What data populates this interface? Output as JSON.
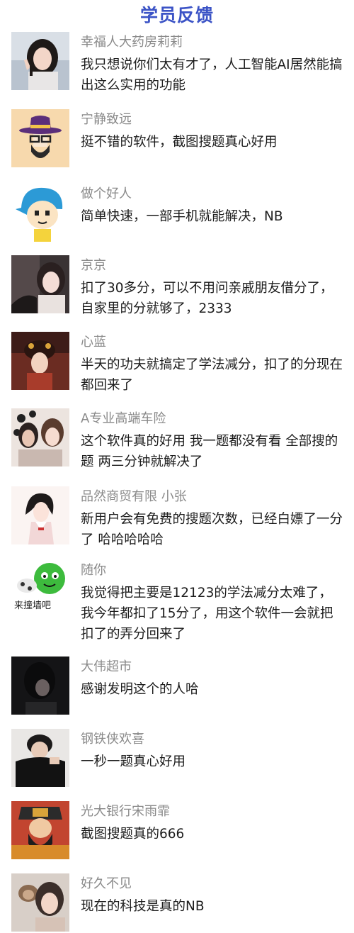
{
  "header": {
    "title": "学员反馈"
  },
  "reviews": [
    {
      "name": "幸福人大药房莉莉",
      "text": "我只想说你们太有才了，人工智能AI居然能搞出这么实用的功能",
      "avatar_icon": "girl-photo-avatar"
    },
    {
      "name": "宁静致远",
      "text": "挺不错的软件，截图搜题真心好用",
      "avatar_icon": "hat-glasses-man-avatar"
    },
    {
      "name": "做个好人",
      "text": "简单快速，一部手机就能解决，NB",
      "avatar_icon": "cartoon-boy-cap-avatar"
    },
    {
      "name": "京京",
      "text": "扣了30多分，可以不用问亲戚朋友借分了，自家里的分就够了，2333",
      "avatar_icon": "girl-in-car-avatar"
    },
    {
      "name": "心蓝",
      "text": "半天的功夫就搞定了学法减分，扣了的分现在都回来了",
      "avatar_icon": "costume-woman-avatar"
    },
    {
      "name": "A专业高端车险",
      "text": "这个软件真的好用 我一题都没有看 全部搜的题 两三分钟就解决了",
      "avatar_icon": "couple-photo-avatar"
    },
    {
      "name": "品然商贸有限 小张",
      "text": "新用户会有免费的搜题次数，已经白嫖了一分了 哈哈哈哈哈",
      "avatar_icon": "illustrated-girl-avatar"
    },
    {
      "name": "随你",
      "text": "我觉得把主要是12123的学法减分太难了，我今年都扣了15分了，用这个软件一会就把扣了的弄分回来了",
      "avatar_icon": "green-monster-sticker-avatar",
      "avatar_caption": "来撞墙吧"
    },
    {
      "name": "大伟超市",
      "text": "感谢发明这个的人哈",
      "avatar_icon": "dark-portrait-avatar"
    },
    {
      "name": "钢铁侠欢喜",
      "text": "一秒一题真心好用",
      "avatar_icon": "boy-covering-face-avatar"
    },
    {
      "name": "光大银行宋雨霏",
      "text": "截图搜题真的666",
      "avatar_icon": "god-of-wealth-avatar"
    },
    {
      "name": "好久不见",
      "text": "现在的科技是真的NB",
      "avatar_icon": "girl-with-monkey-avatar"
    }
  ]
}
